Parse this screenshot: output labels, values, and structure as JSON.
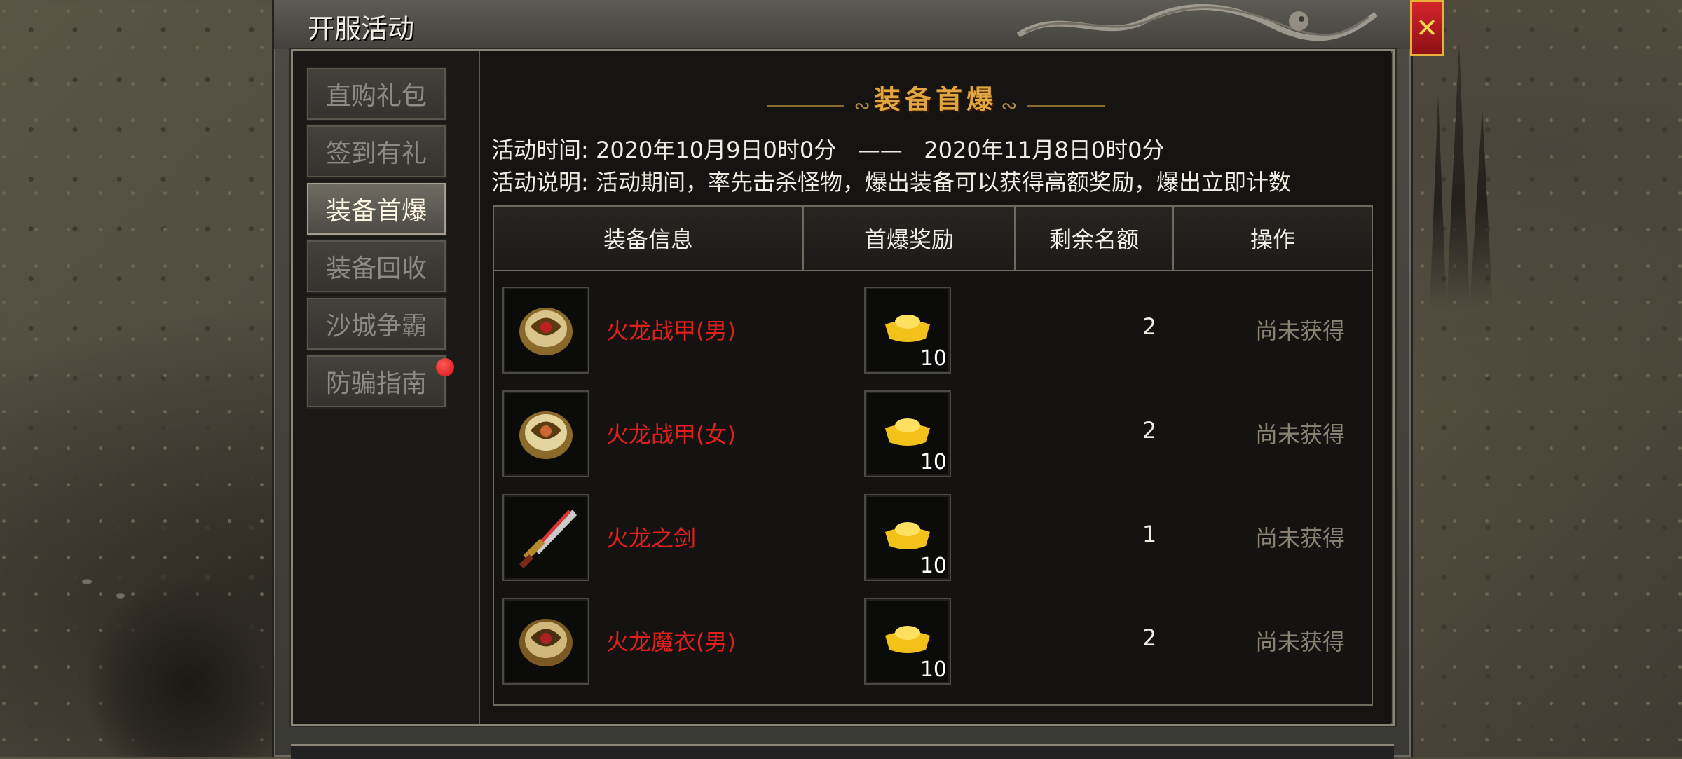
{
  "window": {
    "title": "开服活动",
    "close_icon": "close-icon"
  },
  "sidebar": {
    "items": [
      {
        "label": "直购礼包",
        "active": false,
        "badge": false
      },
      {
        "label": "签到有礼",
        "active": false,
        "badge": false
      },
      {
        "label": "装备首爆",
        "active": true,
        "badge": false
      },
      {
        "label": "装备回收",
        "active": false,
        "badge": false
      },
      {
        "label": "沙城争霸",
        "active": false,
        "badge": false
      },
      {
        "label": "防骗指南",
        "active": false,
        "badge": true
      }
    ]
  },
  "section": {
    "title": "装备首爆",
    "time_label": "活动时间:",
    "time_start": "2020年10月9日0时0分",
    "time_sep": "——",
    "time_end": "2020年11月8日0时0分",
    "desc_label": "活动说明:",
    "desc_text": "活动期间，率先击杀怪物，爆出装备可以获得高额奖励，爆出立即计数"
  },
  "table": {
    "headers": [
      "装备信息",
      "首爆奖励",
      "剩余名额",
      "操作"
    ],
    "rows": [
      {
        "item_icon": "armor-icon",
        "name": "火龙战甲(男)",
        "reward_icon": "gold-ingot-icon",
        "reward_qty": "10",
        "remaining": "2",
        "status": "尚未获得"
      },
      {
        "item_icon": "armor-icon",
        "name": "火龙战甲(女)",
        "reward_icon": "gold-ingot-icon",
        "reward_qty": "10",
        "remaining": "2",
        "status": "尚未获得"
      },
      {
        "item_icon": "sword-icon",
        "name": "火龙之剑",
        "reward_icon": "gold-ingot-icon",
        "reward_qty": "10",
        "remaining": "1",
        "status": "尚未获得"
      },
      {
        "item_icon": "armor-icon",
        "name": "火龙魔衣(男)",
        "reward_icon": "gold-ingot-icon",
        "reward_qty": "10",
        "remaining": "2",
        "status": "尚未获得"
      }
    ]
  },
  "colors": {
    "item_name": "#e1201e",
    "title_gold": "#e2a640",
    "status_dim": "#8b8372",
    "badge_red": "#d10f15"
  }
}
